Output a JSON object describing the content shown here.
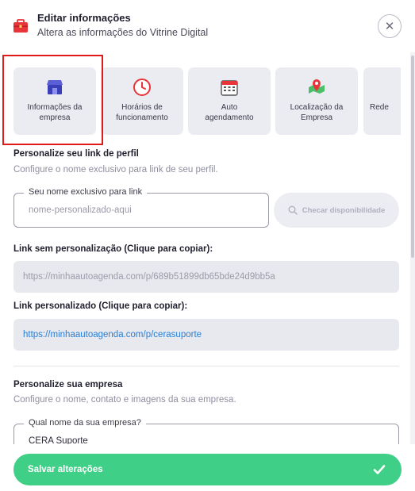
{
  "header": {
    "title": "Editar informações",
    "subtitle": "Altera as informações do Vitrine Digital",
    "close_icon": "close-icon",
    "icon": "briefcase-icon"
  },
  "tabs": [
    {
      "label": "Informações da\nempresa",
      "icon": "storefront-icon",
      "selected": true
    },
    {
      "label": "Horários de\nfuncionamento",
      "icon": "clock-icon"
    },
    {
      "label": "Auto\nagendamento",
      "icon": "calendar-icon"
    },
    {
      "label": "Localização da\nEmpresa",
      "icon": "map-pin-icon"
    },
    {
      "label": "Rede",
      "icon": "share-icon"
    }
  ],
  "profile_link": {
    "title": "Personalize seu link de perfil",
    "description": "Configure o nome exclusivo para link de seu perfil.",
    "input_label": "Seu nome exclusivo para link",
    "input_placeholder": "nome-personalizado-aqui",
    "check_button": "Checar disponibilidade"
  },
  "link_plain": {
    "label": "Link sem personalização (Clique para copiar):",
    "value": "https://minhaautoagenda.com/p/689b51899db65bde24d9bb5a"
  },
  "link_custom": {
    "label": "Link personalizado (Clique para copiar):",
    "value": "https://minhaautoagenda.com/p/cerasuporte"
  },
  "company": {
    "title": "Personalize sua empresa",
    "description": "Configure o nome, contato e imagens da sua empresa.",
    "name_label": "Qual nome da sua empresa?",
    "name_value": "CERA Suporte"
  },
  "footer": {
    "save_label": "Salvar alterações"
  },
  "colors": {
    "accent_green": "#3fcf87",
    "link_blue": "#2a7fd4",
    "highlight_red": "#e0191b",
    "briefcase_red": "#e8353a"
  }
}
